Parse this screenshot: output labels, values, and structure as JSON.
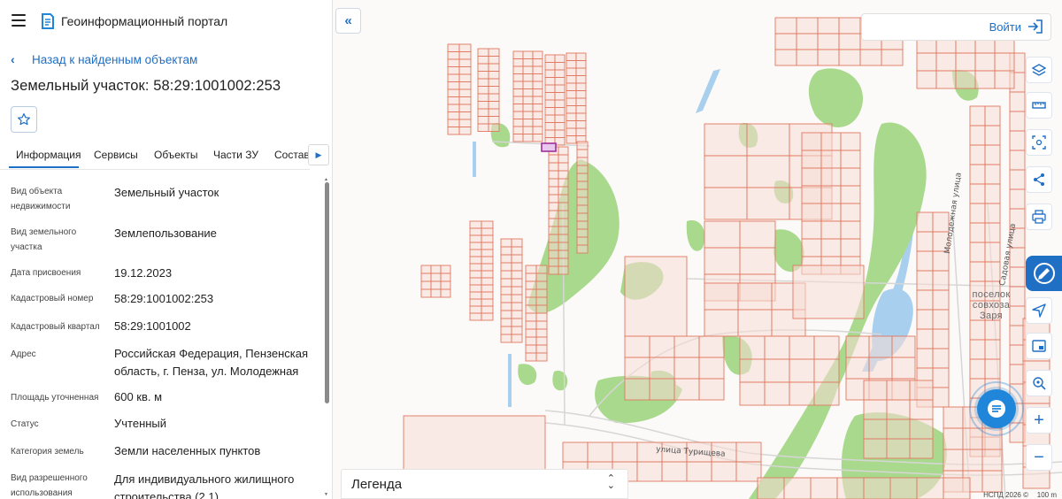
{
  "header": {
    "app_title": "Геоинформационный портал"
  },
  "navigation": {
    "back_label": "Назад к найденным объектам"
  },
  "object": {
    "title": "Земельный участок: 58:29:1001002:253"
  },
  "tabs": [
    {
      "label": "Информация",
      "active": true
    },
    {
      "label": "Сервисы",
      "active": false
    },
    {
      "label": "Объекты",
      "active": false
    },
    {
      "label": "Части ЗУ",
      "active": false
    },
    {
      "label": "Состав",
      "active": false
    }
  ],
  "properties": [
    {
      "label": "Вид объекта недвижимости",
      "value": "Земельный участок"
    },
    {
      "label": "Вид земельного участка",
      "value": "Землепользование"
    },
    {
      "label": "Дата присвоения",
      "value": "19.12.2023"
    },
    {
      "label": "Кадастровый номер",
      "value": "58:29:1001002:253"
    },
    {
      "label": "Кадастровый квартал",
      "value": "58:29:1001002"
    },
    {
      "label": "Адрес",
      "value": "Российская Федерация, Пензенская область, г. Пенза, ул. Молодежная"
    },
    {
      "label": "Площадь уточненная",
      "value": "600 кв. м"
    },
    {
      "label": "Статус",
      "value": "Учтенный"
    },
    {
      "label": "Категория земель",
      "value": "Земли населенных пунктов"
    },
    {
      "label": "Вид разрешенного использования",
      "value": "Для индивидуального жилищного строительства (2.1)"
    }
  ],
  "map": {
    "login_label": "Войти",
    "legend_label": "Легенда",
    "streets": {
      "molodezhnaya": "Молодежная улица",
      "sadovaya": "Садовая улица",
      "turishcheva": "улица Турищева"
    },
    "place_label": "поселок совхоза Заря",
    "attribution": "НСПД 2026 ©",
    "scale": "100 m",
    "tools": [
      "layers-icon",
      "ruler-icon",
      "select-area-icon",
      "share-icon",
      "print-icon",
      "locate-icon",
      "minimap-icon",
      "geo-search-icon"
    ],
    "colors": {
      "accent": "#1f6fc5",
      "parcel_stroke": "#e07860",
      "parcel_fill": "#f7ddd5",
      "vegetation": "#a9d98c",
      "water": "#a8cfee",
      "selected_parcel": "#a0309a"
    }
  }
}
